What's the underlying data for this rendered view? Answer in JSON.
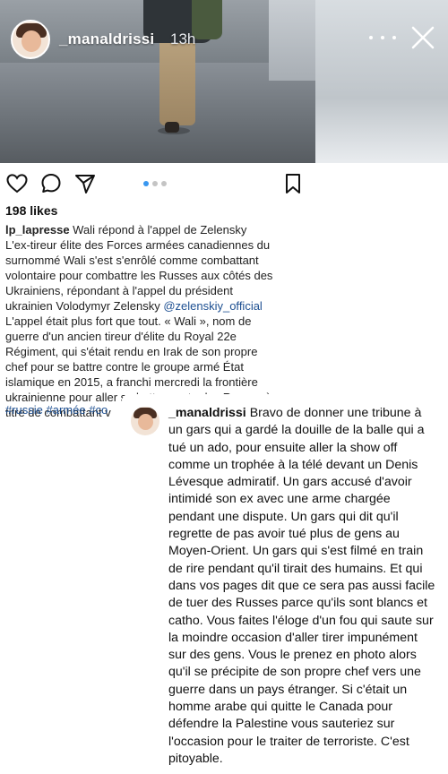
{
  "story": {
    "username": "_manaldrissi",
    "time": "13h"
  },
  "post": {
    "likes": "198 likes",
    "author": "lp_lapresse",
    "caption_lines": [
      " Wali répond à l'appel de Zelensky",
      "L'ex-tireur élite des Forces armées canadiennes du",
      "surnommé Wali s'est s'enrôlé comme combattant",
      "volontaire pour combattre les Russes aux côtés des",
      "Ukrainiens, répondant à l'appel du président",
      "ukrainien Volodymyr Zelensky "
    ],
    "mention": "@zelenskiy_official",
    "caption_rest": [
      "L'appel était plus fort que tout. « Wali », nom de",
      "guerre d'un ancien tireur d'élite du Royal 22e",
      "Régiment, qui s'était rendu en Irak de son propre",
      "chef pour se battre contre le groupe armé État",
      "islamique en 2015, a franchi mercredi la frontière",
      "ukrainienne pour aller se battre contre les Russes à",
      "titre de combattant v"
    ],
    "hashtags": "#russie #armée #co"
  },
  "comment": {
    "author": "_manaldrissi",
    "text": " Bravo de donner une tribune à un gars qui a gardé la douille de la balle qui a tué un ado, pour ensuite aller la show off comme un trophée à la télé devant un Denis Lévesque admiratif. Un gars accusé d'avoir intimidé son ex avec une arme chargée pendant une dispute. Un gars qui dit qu'il regrette de pas avoir tué plus de gens au Moyen-Orient. Un gars qui s'est filmé en train de rire pendant qu'il tirait des humains. Et qui dans vos pages dit que ce sera pas aussi facile de tuer des Russes parce qu'ils sont blancs et catho. Vous faites l'éloge d'un fou qui saute sur la moindre occasion d'aller tirer impunément sur des gens. Vous le prenez en photo alors qu'il se précipite de son propre chef vers une guerre dans un pays étranger. Si c'était un homme arabe qui quitte le Canada pour défendre la Palestine vous sauteriez sur l'occasion pour le traiter de terroriste. C'est pitoyable."
  },
  "icons": {
    "like": "heart-icon",
    "comment": "comment-icon",
    "share": "send-icon",
    "save": "bookmark-icon",
    "more": "more-icon",
    "close": "close-icon"
  },
  "colors": {
    "link": "#1d4f91",
    "carousel_active": "#3897f0"
  }
}
